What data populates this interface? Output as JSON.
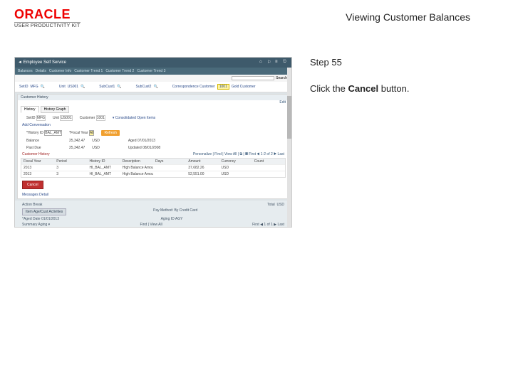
{
  "header": {
    "brand": "ORACLE",
    "brand_sub": "USER PRODUCTIVITY KIT",
    "page_title": "Viewing Customer Balances"
  },
  "instructions": {
    "step_label": "Step 55",
    "text_prefix": "Click the ",
    "bold": "Cancel",
    "text_suffix": " button."
  },
  "app": {
    "titlebar": "◄ Employee Self Service",
    "menubar": [
      "Balances",
      "Details",
      "Customer Info",
      "Customer Trend 1",
      "Customer Trend 2",
      "Customer Trend 3"
    ],
    "search_btn": "Search",
    "ids": {
      "setid_label": "SetID",
      "setid_val": "MFG",
      "unit_label": "Unit",
      "unit_val": "US001",
      "subcust1_label": "SubCust1",
      "subcust2_label": "SubCust2",
      "corr_label": "Correspondence Customer",
      "corr_val": "1001",
      "corr_name": "Gold Customer"
    },
    "panel_title": "Customer History",
    "tabs": {
      "t1": "History",
      "t2": "History Graph"
    },
    "form": {
      "setid2_label": "SetID",
      "setid2_val": "MFG",
      "unit2_label": "Unit",
      "unit2_val": "US001",
      "customer_label": "Customer",
      "customer_val": "1001",
      "consol_icon": "▾",
      "consol_label": "Consolidated Open Items"
    },
    "conv_label": "Add Conversation",
    "hist_row": {
      "histid_label": "*History ID",
      "histid_val": "BAL_AMT",
      "fiscal_label": "*Fiscal Year",
      "fiscal_val": "All",
      "refresh": "Refresh"
    },
    "summary": {
      "balance_label": "Balance",
      "balance_val": "25,342.47",
      "balance_cur": "USD",
      "pastdue_label": "Past Due",
      "pastdue_val": "25,342.47",
      "pastdue_cur": "USD",
      "aged_label": "Aged",
      "aged_val": "07/01/2013",
      "update_label": "Updated",
      "update_val": "08/01/2008"
    },
    "cust_hist_title": "Customer History",
    "grid_toolbar": "Personalize | Find | View All | ⧉ | ▦   First ◀ 1-2 of 2 ▶ Last",
    "grid": {
      "h1": "Fiscal Year",
      "h2": "Period",
      "h3": "History ID",
      "h4": "Description",
      "h5": "Days",
      "h6": "Amount",
      "h7": "Currency",
      "h8": "Count",
      "r1": {
        "c1": "2013",
        "c2": "3",
        "c3": "HI_BAL_AMT",
        "c4": "High Balance Amount",
        "c5": "",
        "c6": "37,682.26",
        "c7": "USD",
        "c8": ""
      },
      "r2": {
        "c1": "2013",
        "c2": "3",
        "c3": "HI_BAL_AMT",
        "c4": "High Balance Amount",
        "c5": "",
        "c6": "52,551.00",
        "c7": "USD",
        "c8": ""
      }
    },
    "cancel_btn": "Cancel",
    "msg_label": "Messages Detail",
    "footer": {
      "row1_label": "Action Break",
      "row1_btn": "Item Age/Cust Activities",
      "row1_mid": "Pay Method: By Credit Card",
      "row1_r1": "Total",
      "row1_r2": "USD",
      "row2_l": "*Aged Date 01/01/2013",
      "row2_m": "Aging ID  AGY",
      "row3_l": "Summary Aging ▾",
      "row3_m": "Find | View All",
      "row3_r": "First ◀ 1 of 1 ▶ Last"
    },
    "edit_link": "Edit"
  }
}
